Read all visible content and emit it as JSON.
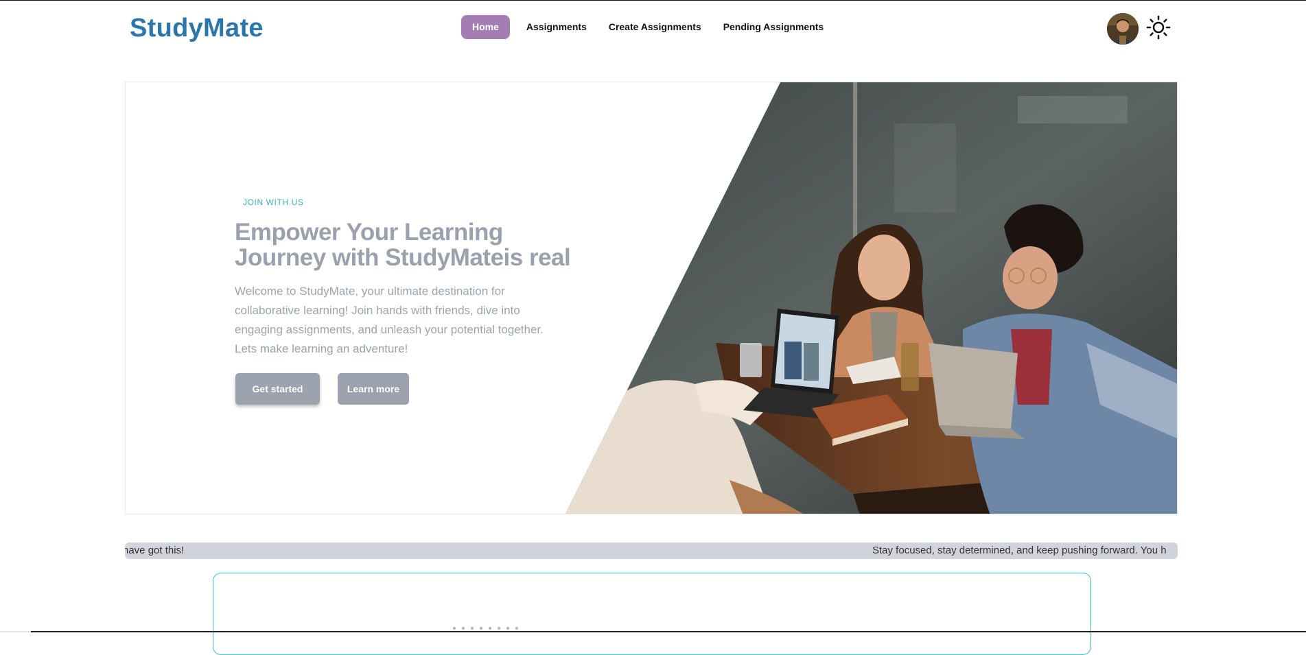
{
  "brand": {
    "name": "StudyMate",
    "color": "#2a77ab"
  },
  "nav": {
    "items": [
      {
        "label": "Home",
        "active": true
      },
      {
        "label": "Assignments",
        "active": false
      },
      {
        "label": "Create Assignments",
        "active": false
      },
      {
        "label": "Pending Assignments",
        "active": false
      }
    ],
    "active_color": "#a57db5"
  },
  "header": {
    "avatar_icon": "user-avatar",
    "theme_icon": "sun-icon"
  },
  "hero": {
    "eyebrow": "JOIN WITH US",
    "title": "Empower Your Learning Journey with StudyMateis real",
    "description": "Welcome to StudyMate, your ultimate destination for collaborative learning! Join hands with friends, dive into engaging assignments, and unleash your potential together. Lets make learning an adventure!",
    "primary_button": "Get started",
    "secondary_button": "Learn more",
    "image_icon": "students-studying-photo"
  },
  "marquee": {
    "left_text": "have got this!",
    "right_text": "Stay focused, stay determined, and keep pushing forward. You h"
  },
  "carousel": {
    "dot_count": 8
  }
}
